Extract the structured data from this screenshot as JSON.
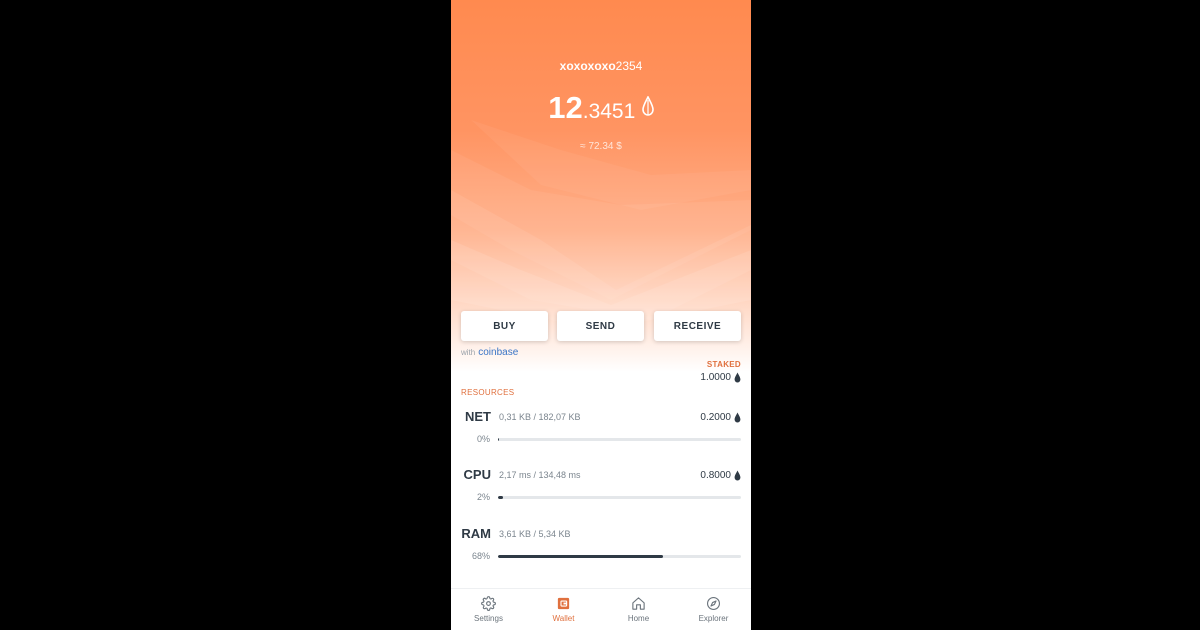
{
  "colors": {
    "accent": "#e0703e",
    "hero_top": "#ff8a4f",
    "text_dark": "#2f3a45",
    "text_muted": "#7b858e",
    "bar_fill": "#2f3a45",
    "bar_track": "#e4e7ea"
  },
  "account": {
    "name_bold": "xoxoxoxo",
    "name_rest": "2354"
  },
  "balance": {
    "integer": "12",
    "decimal": ".3451",
    "fiat": "≈ 72.34 $",
    "token_icon": "eos-drop-icon"
  },
  "actions": {
    "buy_label": "BUY",
    "send_label": "SEND",
    "receive_label": "RECEIVE",
    "with_label": "with",
    "provider_label": "coinbase"
  },
  "staked": {
    "label": "STAKED",
    "value": "1.0000"
  },
  "resources": {
    "label": "RESOURCES",
    "items": [
      {
        "name": "NET",
        "usage": "0,31 KB / 182,07 KB",
        "stake": "0.2000",
        "percent_label": "0%",
        "percent": 0.5
      },
      {
        "name": "CPU",
        "usage": "2,17 ms / 134,48 ms",
        "stake": "0.8000",
        "percent_label": "2%",
        "percent": 2
      },
      {
        "name": "RAM",
        "usage": "3,61 KB / 5,34 KB",
        "stake": "",
        "percent_label": "68%",
        "percent": 68
      }
    ]
  },
  "tabs": [
    {
      "label": "Settings",
      "icon": "gear-icon",
      "active": false
    },
    {
      "label": "Wallet",
      "icon": "wallet-icon",
      "active": true
    },
    {
      "label": "Home",
      "icon": "home-icon",
      "active": false
    },
    {
      "label": "Explorer",
      "icon": "compass-icon",
      "active": false
    }
  ]
}
